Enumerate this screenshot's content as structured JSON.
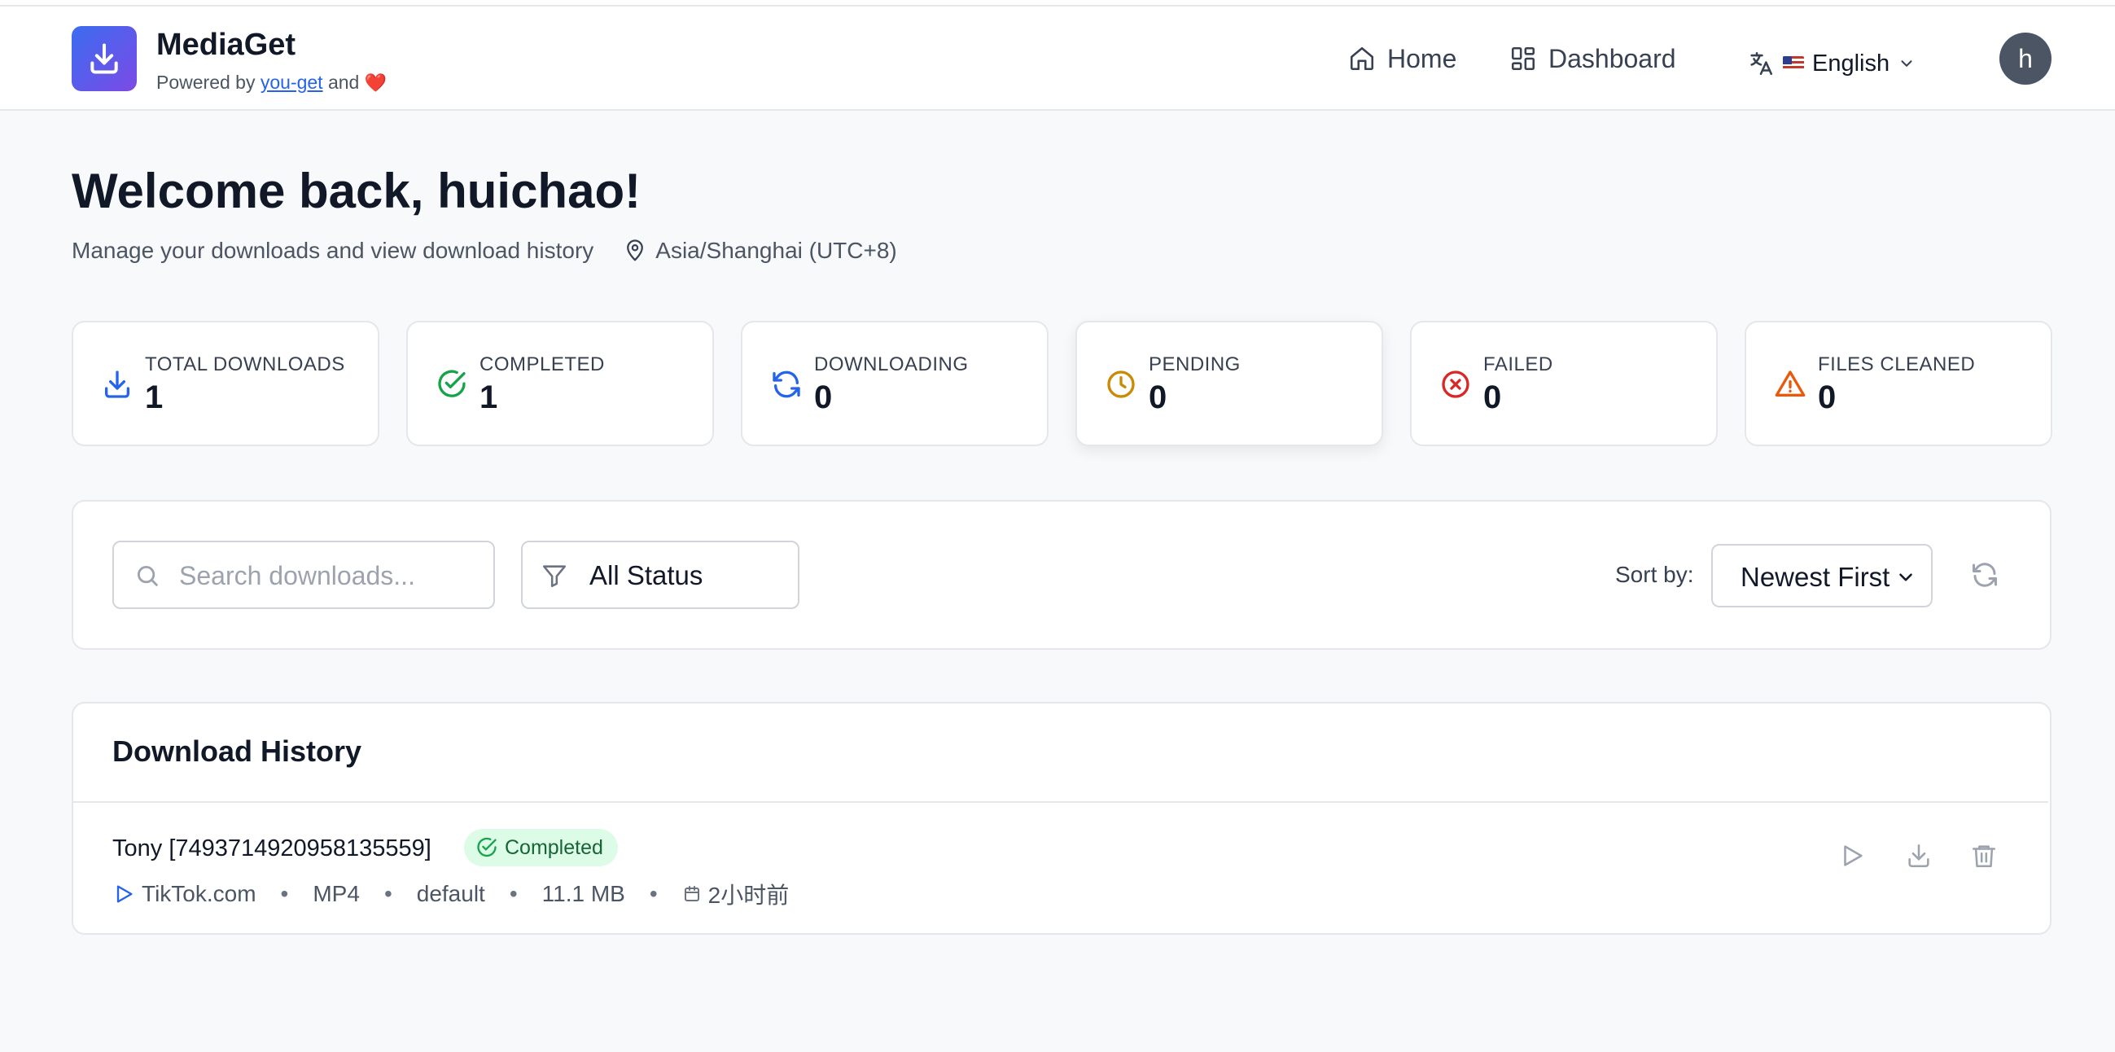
{
  "header": {
    "brand_name": "MediaGet",
    "powered_prefix": "Powered by",
    "powered_link": "you-get",
    "powered_suffix": "and",
    "heart": "❤️",
    "nav": [
      {
        "label": "Home",
        "icon": "home-icon"
      },
      {
        "label": "Dashboard",
        "icon": "dashboard-icon"
      }
    ],
    "language": "English",
    "avatar_initial": "h"
  },
  "welcome": {
    "title": "Welcome back, huichao!",
    "subtitle": "Manage your downloads and view download history",
    "timezone": "Asia/Shanghai (UTC+8)"
  },
  "stats": [
    {
      "label": "TOTAL DOWNLOADS",
      "value": "1",
      "icon": "download-icon",
      "color": "#2563eb"
    },
    {
      "label": "COMPLETED",
      "value": "1",
      "icon": "check-circle-icon",
      "color": "#16a34a"
    },
    {
      "label": "DOWNLOADING",
      "value": "0",
      "icon": "refresh-icon",
      "color": "#2563eb"
    },
    {
      "label": "PENDING",
      "value": "0",
      "icon": "clock-icon",
      "color": "#ca8a04"
    },
    {
      "label": "FAILED",
      "value": "0",
      "icon": "x-circle-icon",
      "color": "#dc2626"
    },
    {
      "label": "FILES CLEANED",
      "value": "0",
      "icon": "warning-icon",
      "color": "#ea580c"
    }
  ],
  "filters": {
    "search_placeholder": "Search downloads...",
    "status_selected": "All Status",
    "sort_label": "Sort by:",
    "sort_selected": "Newest First"
  },
  "history": {
    "title": "Download History",
    "items": [
      {
        "title": "Tony [7493714920958135559]",
        "status": "Completed",
        "site": "TikTok.com",
        "format": "MP4",
        "quality": "default",
        "size": "11.1 MB",
        "time": "2小时前"
      }
    ]
  },
  "colors": {
    "accent": "#2563eb",
    "brand_gradient_start": "#3b6cf0",
    "brand_gradient_end": "#7c4ae6",
    "success_bg": "#dcfce7",
    "success_text": "#166534"
  }
}
